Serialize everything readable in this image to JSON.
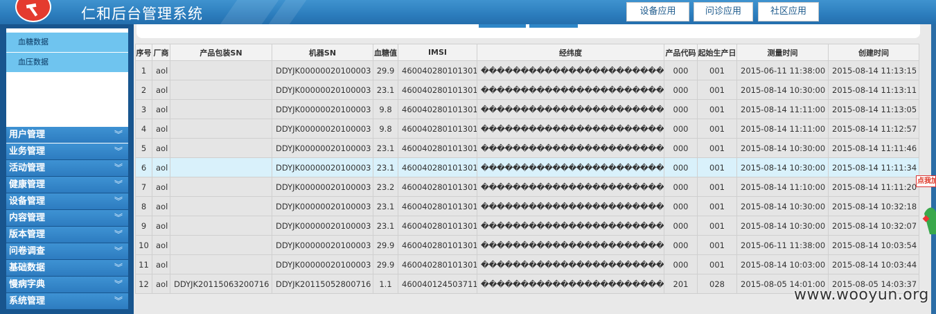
{
  "header": {
    "title": "仁和后台管理系统",
    "tabs": [
      {
        "label": "设备应用"
      },
      {
        "label": "问诊应用"
      },
      {
        "label": "社区应用"
      }
    ]
  },
  "sidebar": {
    "sub_items": [
      {
        "label": "血糖数据"
      },
      {
        "label": "血压数据"
      }
    ],
    "menu": [
      {
        "label": "用户管理"
      },
      {
        "label": "业务管理"
      },
      {
        "label": "活动管理"
      },
      {
        "label": "健康管理"
      },
      {
        "label": "设备管理"
      },
      {
        "label": "内容管理"
      },
      {
        "label": "版本管理"
      },
      {
        "label": "问卷调查"
      },
      {
        "label": "基础数据"
      },
      {
        "label": "慢病字典"
      },
      {
        "label": "系统管理"
      }
    ],
    "chevron_icon": "double-chevron-down-icon"
  },
  "table": {
    "columns": [
      "序号",
      "厂商",
      "产品包装SN",
      "机器SN",
      "血糖值",
      "IMSI",
      "经纬度",
      "产品代码",
      "起始生产日",
      "测量时间",
      "创建时间"
    ],
    "rows": [
      [
        "1",
        "aol",
        "",
        "DDYJK00000020100003",
        "29.9",
        "460040280101301",
        "��������������������������",
        "000",
        "001",
        "2015-06-11 11:38:00",
        "2015-08-14 11:13:15"
      ],
      [
        "2",
        "aol",
        "",
        "DDYJK00000020100003",
        "23.1",
        "460040280101301",
        "��������������������������",
        "000",
        "001",
        "2015-08-14 10:30:00",
        "2015-08-14 11:13:11"
      ],
      [
        "3",
        "aol",
        "",
        "DDYJK00000020100003",
        "9.8",
        "460040280101301",
        "��������������������������",
        "000",
        "001",
        "2015-08-14 11:11:00",
        "2015-08-14 11:13:05"
      ],
      [
        "4",
        "aol",
        "",
        "DDYJK00000020100003",
        "9.8",
        "460040280101301",
        "��������������������������",
        "000",
        "001",
        "2015-08-14 11:11:00",
        "2015-08-14 11:12:57"
      ],
      [
        "5",
        "aol",
        "",
        "DDYJK00000020100003",
        "23.1",
        "460040280101301",
        "��������������������������",
        "000",
        "001",
        "2015-08-14 10:30:00",
        "2015-08-14 11:11:46"
      ],
      [
        "6",
        "aol",
        "",
        "DDYJK00000020100003",
        "23.1",
        "460040280101301",
        "��������������������������",
        "000",
        "001",
        "2015-08-14 10:30:00",
        "2015-08-14 11:11:34"
      ],
      [
        "7",
        "aol",
        "",
        "DDYJK00000020100003",
        "23.2",
        "460040280101301",
        "��������������������������",
        "000",
        "001",
        "2015-08-14 11:10:00",
        "2015-08-14 11:11:20"
      ],
      [
        "8",
        "aol",
        "",
        "DDYJK00000020100003",
        "23.1",
        "460040280101301",
        "��������������������������",
        "000",
        "001",
        "2015-08-14 10:30:00",
        "2015-08-14 10:32:18"
      ],
      [
        "9",
        "aol",
        "",
        "DDYJK00000020100003",
        "23.1",
        "460040280101301",
        "��������������������������",
        "000",
        "001",
        "2015-08-14 10:30:00",
        "2015-08-14 10:32:07"
      ],
      [
        "10",
        "aol",
        "",
        "DDYJK00000020100003",
        "29.9",
        "460040280101301",
        "��������������������������",
        "000",
        "001",
        "2015-06-11 11:38:00",
        "2015-08-14 10:03:54"
      ],
      [
        "11",
        "aol",
        "",
        "DDYJK00000020100003",
        "29.9",
        "460040280101301",
        "��������������������������",
        "000",
        "001",
        "2015-08-14 10:03:00",
        "2015-08-14 10:03:44"
      ],
      [
        "12",
        "aol",
        "DDYJK20115063200716",
        "DDYJK20115052800716",
        "1.1",
        "460040124503711",
        "��������������������������",
        "201",
        "028",
        "2015-08-05 14:01:00",
        "2015-08-05 14:03:37"
      ]
    ],
    "highlighted_row": 6
  },
  "float_ad": {
    "label": "点我加"
  },
  "watermark": "www.wooyun.org",
  "colors": {
    "header_blue": "#2c7dbd",
    "sidebar_blue": "#18558e",
    "submenu_active": "#6fc4ef",
    "row_highlight": "#d9f1fb"
  }
}
